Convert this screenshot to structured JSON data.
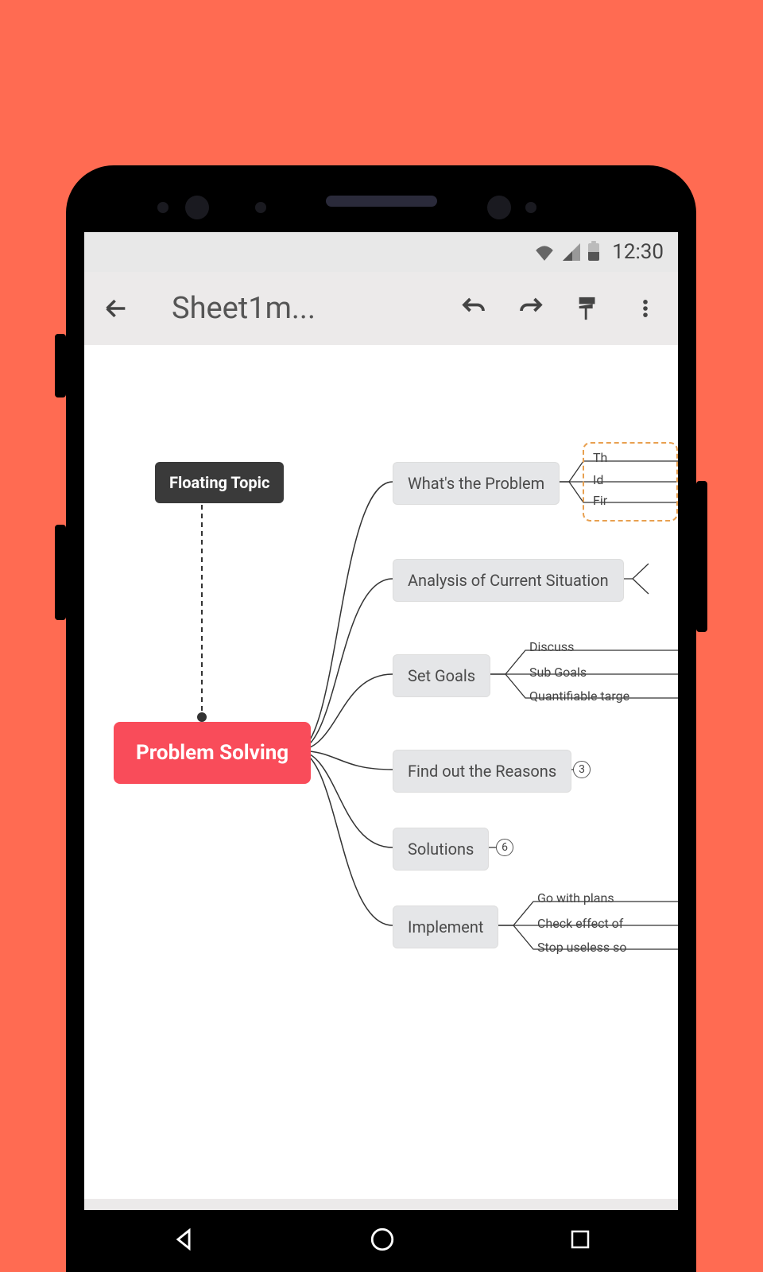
{
  "status": {
    "time": "12:30"
  },
  "toolbar": {
    "title": "Sheet1m..."
  },
  "mindmap": {
    "central": "Problem Solving",
    "floating": "Floating Topic",
    "branches": [
      {
        "label": "What's the Problem",
        "children": [
          "Th",
          "Id",
          "Fir"
        ]
      },
      {
        "label": "Analysis of Current Situation",
        "children": []
      },
      {
        "label": "Set Goals",
        "children": [
          "Discuss",
          "Sub Goals",
          "Quantifiable targe"
        ]
      },
      {
        "label": "Find out the Reasons",
        "count": "3"
      },
      {
        "label": "Solutions",
        "count": "6"
      },
      {
        "label": "Implement",
        "children": [
          "Go with plans",
          "Check effect of",
          "Stop useless so"
        ]
      }
    ]
  }
}
